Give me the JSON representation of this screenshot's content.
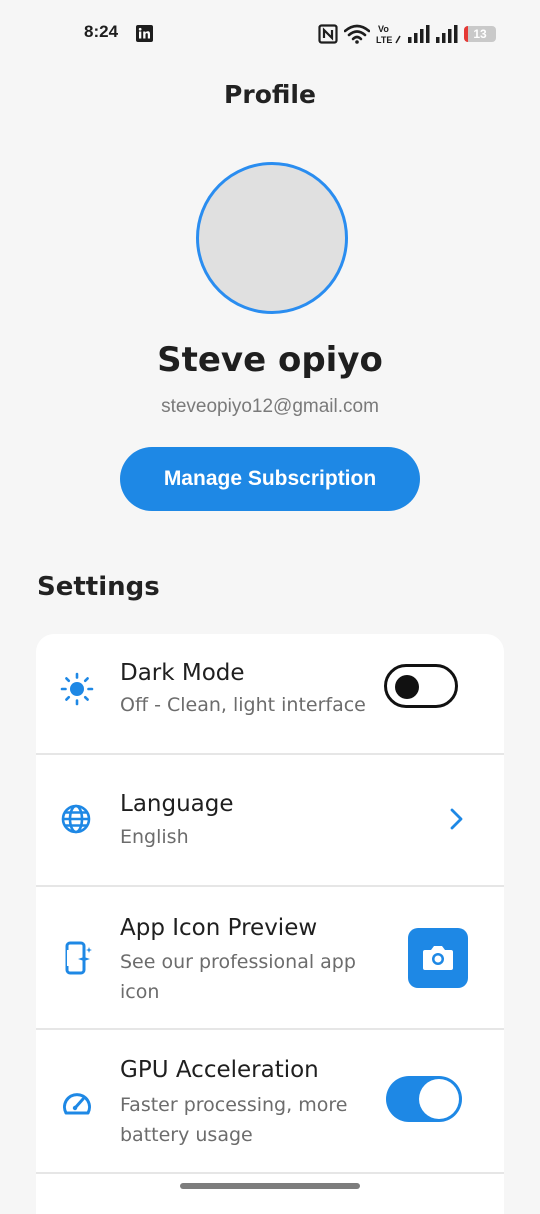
{
  "status_bar": {
    "time": "8:24",
    "battery_level": "13",
    "icons": [
      "linkedin-icon",
      "nfc-icon",
      "wifi-icon",
      "volte-icon",
      "signal-icon",
      "signal-icon-2",
      "battery-icon"
    ],
    "volte_line1": "Vo",
    "volte_line2": "LTE"
  },
  "header": {
    "title": "Profile"
  },
  "profile": {
    "name": "Steve opiyo",
    "email": "steveopiyo12@gmail.com",
    "manage_button": "Manage Subscription"
  },
  "settings": {
    "section_title": "Settings",
    "items": [
      {
        "title": "Dark Mode",
        "subtitle": "Off - Clean, light interface",
        "icon": "sun-icon",
        "control": "toggle",
        "toggle_on": false
      },
      {
        "title": "Language",
        "subtitle": "English",
        "icon": "globe-icon",
        "control": "chevron"
      },
      {
        "title": "App Icon Preview",
        "subtitle": "See our professional app icon",
        "icon": "app-sparkle-icon",
        "control": "camera-button"
      },
      {
        "title": "GPU Acceleration",
        "subtitle": "Faster processing, more battery usage",
        "icon": "speedometer-icon",
        "control": "toggle",
        "toggle_on": true
      }
    ]
  },
  "colors": {
    "accent": "#1e88e5",
    "avatar_border": "#2a8df0",
    "background": "#f6f6f6",
    "battery_low": "#e53935"
  }
}
